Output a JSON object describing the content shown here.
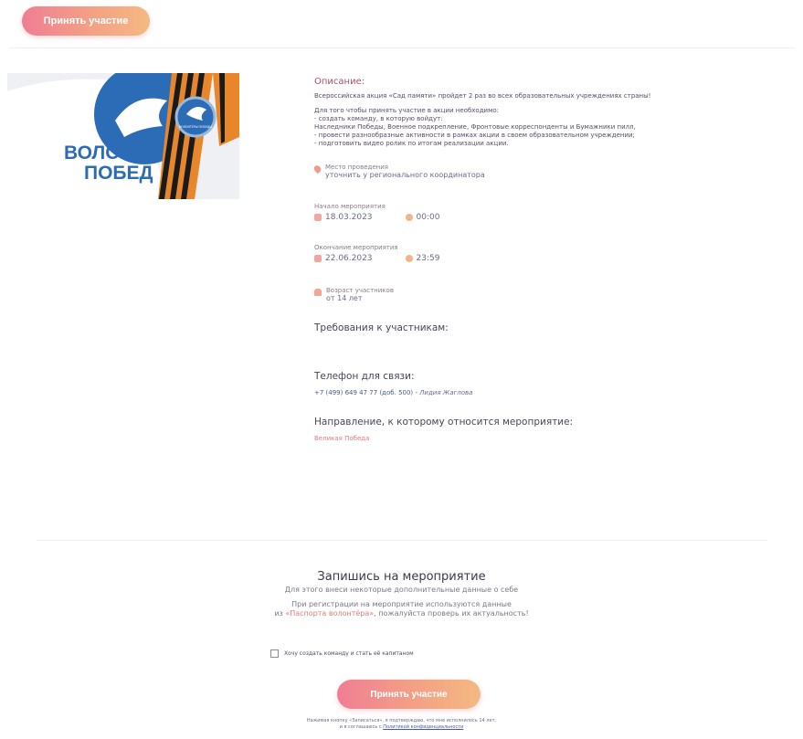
{
  "header": {
    "join_label": "Принять участие"
  },
  "hero": {
    "badge_text": "ВОЛОНТЕРЫ ПОБЕДЫ",
    "shirt_text_1": "ВОЛОНТ",
    "shirt_text_2": "ПОБЕД"
  },
  "description": {
    "title": "Описание:",
    "lead": "Всероссийская акция «Сад памяти» пройдет 2 раз во всех образовательных учреждениях страны!",
    "intro": "Для того чтобы принять участие в акции необходимо:",
    "items": [
      "- создать команду, в которую войдут:",
      "Наследники Победы, Военное подкрепление, Фронтовые корреспонденты и Бумажники пилл,",
      "- провести разнообразные активности в рамках акции в своем образовательном учреждении;",
      "- подготовить видео ролик по итогам реализации акции."
    ]
  },
  "place": {
    "label": "Место проведения",
    "value": "уточнить у регионального координатора"
  },
  "start": {
    "label": "Начало мероприятия",
    "date": "18.03.2023",
    "time": "00:00"
  },
  "end": {
    "label": "Окончание мероприятия",
    "date": "22.06.2023",
    "time": "23:59"
  },
  "age": {
    "label": "Возраст участников",
    "value": "от 14 лет"
  },
  "requirements": {
    "title": "Требования к участникам:"
  },
  "contact": {
    "title": "Телефон для связи:",
    "phone": "+7 (499) 649 47 77 (доб. 500) -",
    "person": "Лидия Жаглова"
  },
  "direction": {
    "title": "Направление, к которому относится мероприятие:",
    "value": "Великая Победа"
  },
  "register": {
    "title": "Запишись на мероприятие",
    "subtitle": "Для этого внеси некоторые дополнительные данные о себе",
    "line1": "При регистрации на мероприятие используются данные",
    "line2_prefix": "из ",
    "line2_link": "«Паспорта волонтёра»",
    "line2_suffix": ", пожалуйста проверь их актуальность!",
    "team_checkbox_label": "Хочу создать команду и стать её капитаном",
    "join_label": "Принять участие",
    "legal_line1": "Нажимая кнопку «Записаться», я подтверждаю, что мне исполнилось 14 лет,",
    "legal_line2_prefix": "и я соглашаюсь с ",
    "legal_link": "Политикой конфиденциальности"
  },
  "colors": {
    "accent_start": "#ef7e94",
    "accent_end": "#f4b981",
    "link": "#e57a7a",
    "heading": "#a5526a"
  }
}
